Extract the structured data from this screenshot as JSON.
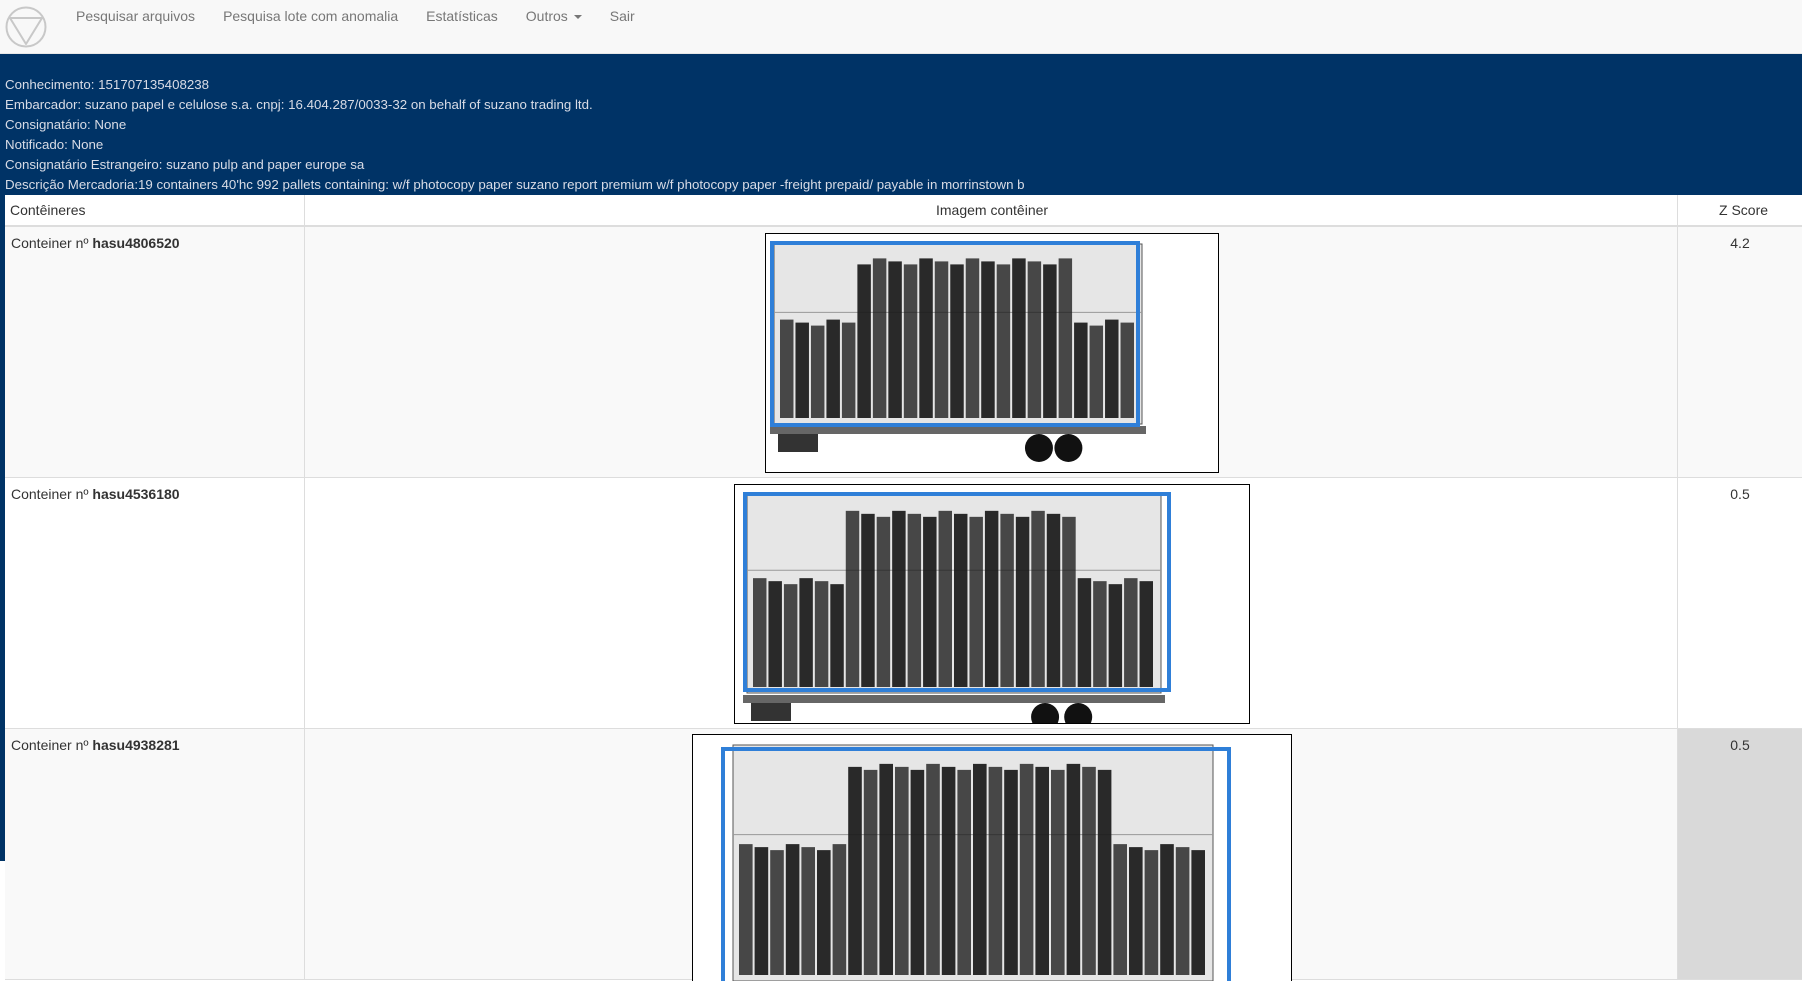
{
  "nav": {
    "items": [
      "Pesquisar arquivos",
      "Pesquisa lote com anomalia",
      "Estatísticas",
      "Outros",
      "Sair"
    ],
    "logo_icon": "triangle-circle-logo-icon"
  },
  "info": {
    "conhecimento": "Conhecimento: 151707135408238",
    "embarcador": "Embarcador: suzano papel e celulose s.a. cnpj: 16.404.287/0033-32 on behalf of suzano trading ltd.",
    "consignatario": "Consignatário: None",
    "notificado": "Notificado: None",
    "consignatario_estrangeiro": "Consignatário Estrangeiro: suzano pulp and paper europe sa",
    "descricao": "Descrição Mercadoria:19 containers 40'hc 992 pallets containing: w/f photocopy paper suzano report premium w/f photocopy paper -freight prepaid/ payable in morrinstown b"
  },
  "table": {
    "headers": {
      "containers": "Contêineres",
      "image": "Imagem contêiner",
      "zscore": "Z Score"
    },
    "rows": [
      {
        "prefix": "Conteiner nº ",
        "id": "hasu4806520",
        "zscore": "4.2"
      },
      {
        "prefix": "Conteiner nº ",
        "id": "hasu4536180",
        "zscore": "0.5"
      },
      {
        "prefix": "Conteiner nº ",
        "id": "hasu4938281",
        "zscore": "0.5"
      }
    ]
  },
  "colors": {
    "navbar_bg": "#f8f8f8",
    "info_bg": "#003366",
    "detection_box": "#2f7fd8",
    "zscore_highlight": "#d9d9d9"
  }
}
